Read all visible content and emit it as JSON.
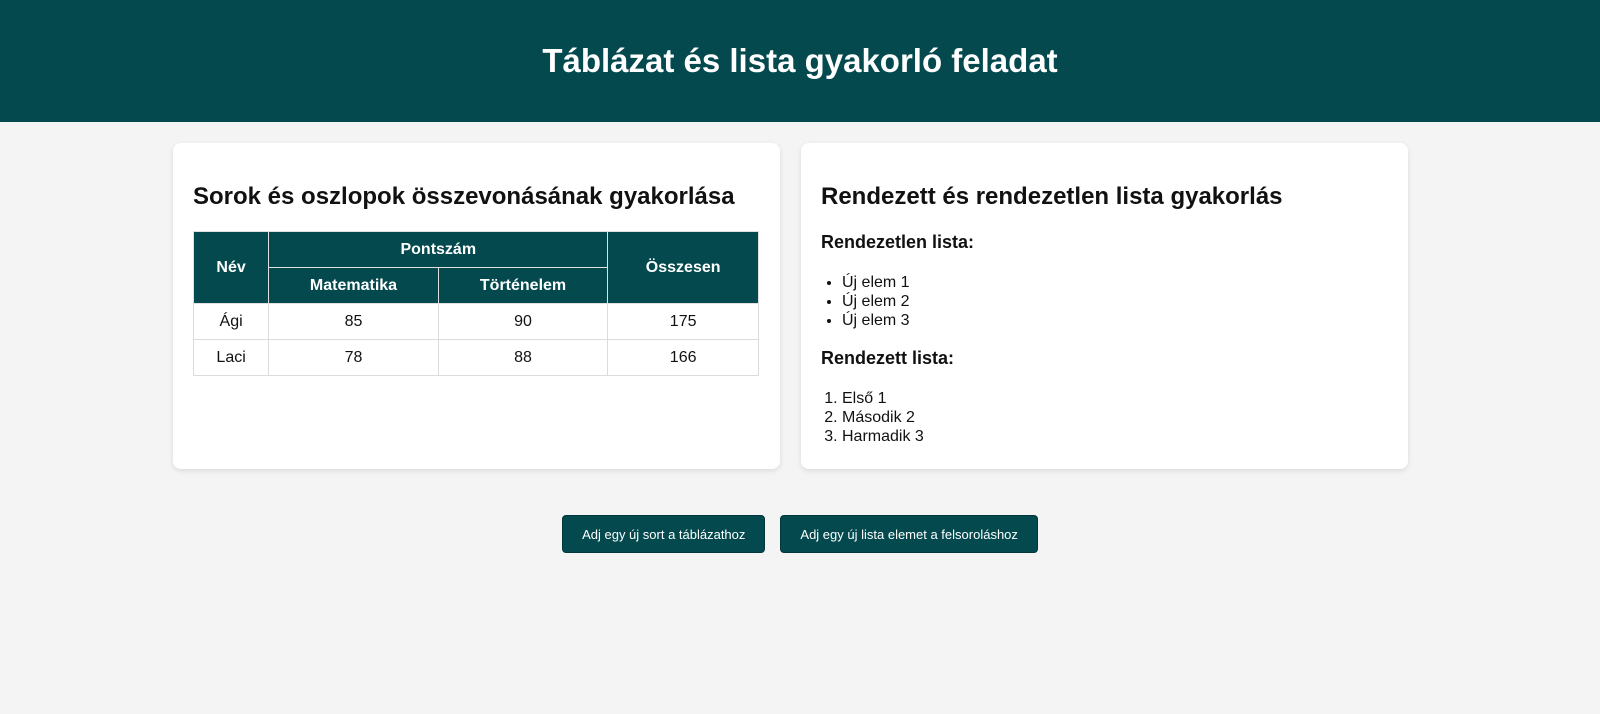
{
  "header": {
    "title": "Táblázat és lista gyakorló feladat"
  },
  "table_card": {
    "title": "Sorok és oszlopok összevonásának gyakorlása",
    "headers": {
      "name": "Név",
      "points": "Pontszám",
      "math": "Matematika",
      "history": "Történelem",
      "total": "Összesen"
    },
    "rows": [
      {
        "name": "Ági",
        "math": "85",
        "history": "90",
        "total": "175"
      },
      {
        "name": "Laci",
        "math": "78",
        "history": "88",
        "total": "166"
      }
    ]
  },
  "list_card": {
    "title": "Rendezett és rendezetlen lista gyakorlás",
    "unordered_title": "Rendezetlen lista:",
    "unordered_items": [
      "Új elem 1",
      "Új elem 2",
      "Új elem 3"
    ],
    "ordered_title": "Rendezett lista:",
    "ordered_items": [
      "Első 1",
      "Második 2",
      "Harmadik 3"
    ]
  },
  "buttons": {
    "add_row": "Adj egy új sort a táblázathoz",
    "add_list_item": "Adj egy új lista elemet a felsoroláshoz"
  },
  "colors": {
    "primary": "#03494e",
    "background": "#f4f4f4"
  }
}
